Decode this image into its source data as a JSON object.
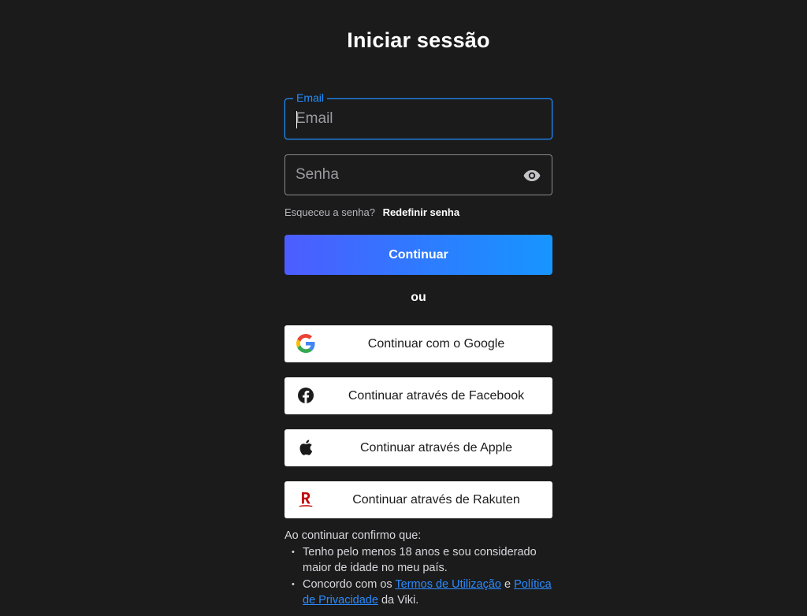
{
  "page": {
    "title": "Iniciar sessão"
  },
  "email": {
    "label": "Email",
    "placeholder": "Email",
    "value": ""
  },
  "password": {
    "placeholder": "Senha",
    "value": "",
    "toggle_icon": "eye-icon"
  },
  "forgot": {
    "text": "Esqueceu a senha?",
    "link": "Redefinir senha"
  },
  "continue_button": {
    "label": "Continuar"
  },
  "separator": {
    "text": "ou"
  },
  "social": {
    "google": {
      "label": "Continuar com o Google",
      "icon": "google-icon"
    },
    "facebook": {
      "label": "Continuar através de Facebook",
      "icon": "facebook-icon"
    },
    "apple": {
      "label": "Continuar através de Apple",
      "icon": "apple-icon"
    },
    "rakuten": {
      "label": "Continuar através de Rakuten",
      "icon": "rakuten-icon"
    }
  },
  "legal": {
    "intro": "Ao continuar confirmo que:",
    "item1": "Tenho pelo menos 18 anos e sou considerado maior de idade no meu país.",
    "item2_prefix": "Concordo com os ",
    "terms_link": "Termos de Utilização",
    "item2_mid": " e ",
    "privacy_link": "Política de Privacidade",
    "item2_suffix": " da Viki."
  },
  "colors": {
    "background": "#1b1b1c",
    "accent_blue": "#1f8fff",
    "button_gradient_start": "#4d5cff",
    "button_gradient_end": "#1795ff",
    "link": "#2b8cff"
  }
}
